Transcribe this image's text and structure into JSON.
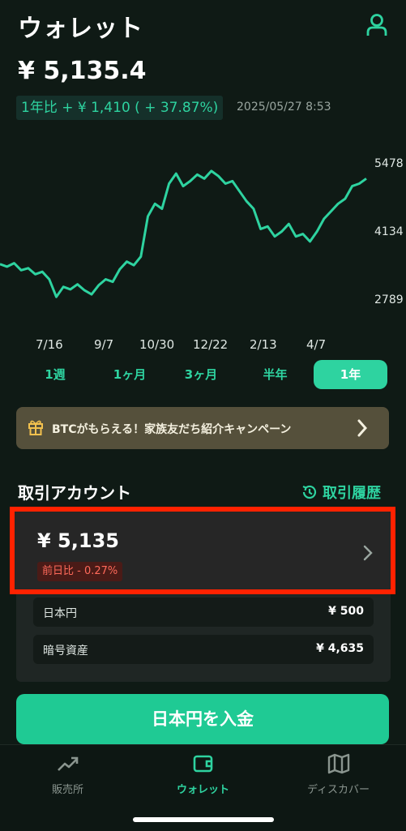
{
  "header": {
    "title": "ウォレット",
    "user_icon": "user-icon",
    "balance": "¥ 5,135.4",
    "yearly_change": "1年比 + ¥ 1,410 ( + 37.87%)",
    "timestamp": "2025/05/27 8:53"
  },
  "chart_data": {
    "type": "line",
    "y_tick_labels": [
      "5478",
      "4134",
      "2789"
    ],
    "x_tick_labels": [
      "7/16",
      "9/7",
      "10/30",
      "12/22",
      "2/13",
      "4/7"
    ],
    "ylim": [
      2789,
      5478
    ],
    "series": [
      {
        "color": "#2ed3a0",
        "values": [
          3500,
          3450,
          3520,
          3380,
          3420,
          3300,
          3350,
          3200,
          2850,
          3050,
          3000,
          3100,
          2980,
          2900,
          3080,
          3200,
          3150,
          3400,
          3550,
          3480,
          3650,
          4450,
          4700,
          4600,
          5100,
          5300,
          5050,
          5150,
          5280,
          5200,
          5350,
          5250,
          5100,
          5150,
          4950,
          4750,
          4600,
          4200,
          4250,
          4050,
          4150,
          4300,
          4050,
          4100,
          3950,
          4150,
          4400,
          4550,
          4700,
          4800,
          5050,
          5100,
          5200
        ]
      }
    ]
  },
  "periods": [
    "1週",
    "1ヶ月",
    "3ヶ月",
    "半年",
    "1年"
  ],
  "active_period_index": 4,
  "banner": {
    "icon": "gift-icon",
    "text": "BTCがもらえる！家族友だち紹介キャンペーン"
  },
  "accounts": {
    "title": "取引アカウント",
    "history_label": "取引履歴",
    "amount": "¥ 5,135",
    "daily_change": "前日比 - 0.27%",
    "rows": [
      {
        "label": "日本円",
        "value": "¥ 500"
      },
      {
        "label": "暗号資産",
        "value": "¥ 4,635"
      }
    ]
  },
  "deposit_button": "日本円を入金",
  "tabbar": [
    {
      "label": "販売所",
      "icon": "trend-icon"
    },
    {
      "label": "ウォレット",
      "icon": "wallet-icon"
    },
    {
      "label": "ディスカバー",
      "icon": "map-icon"
    }
  ],
  "active_tab_index": 1,
  "colors": {
    "accent": "#2ed3a0",
    "background": "#0f1a15",
    "negative": "#ff6a5a",
    "highlight_border": "#ff2200"
  }
}
